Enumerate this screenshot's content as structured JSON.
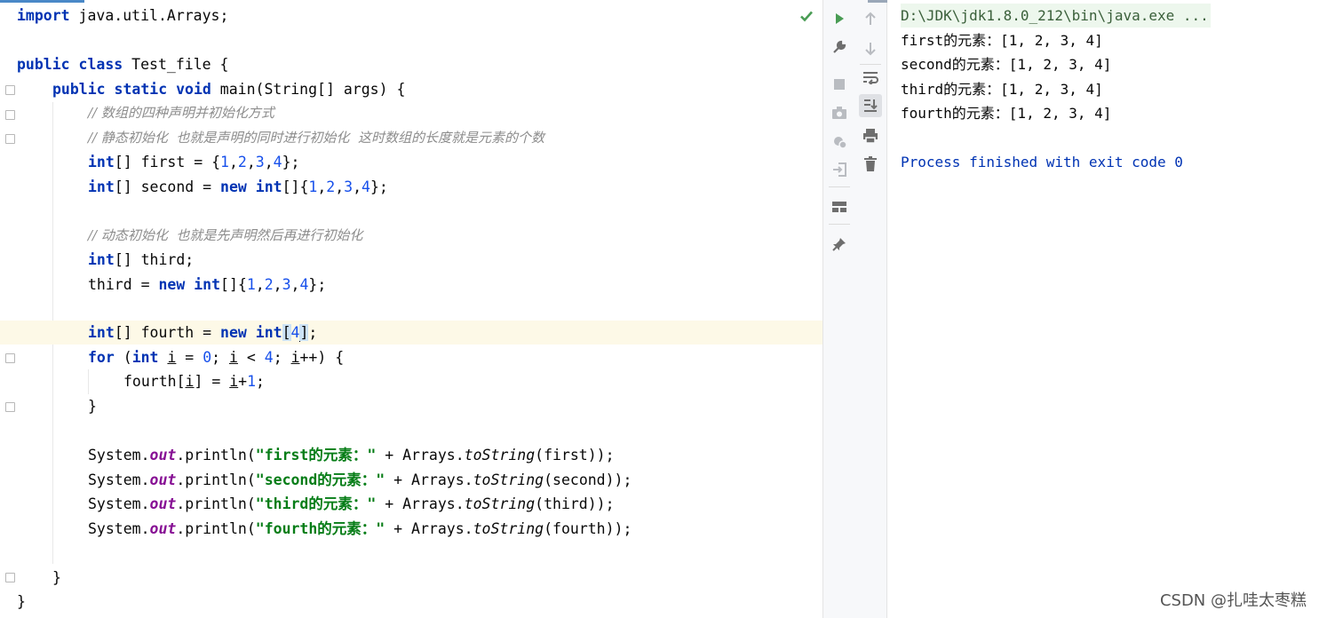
{
  "editor": {
    "status_icon": "checkmark-icon",
    "lines": {
      "l1": {
        "kw": "import",
        "rest": " java.util.Arrays;"
      },
      "l3": {
        "kw1": "public",
        "kw2": "class",
        "rest": " Test_file {"
      },
      "l4": {
        "kw1": "public",
        "kw2": "static",
        "kw3": "void",
        "rest": " main(String[] args) {"
      },
      "l5": {
        "comment": "// 数组的四种声明并初始化方式"
      },
      "l6": {
        "comment": "// 静态初始化  也就是声明的同时进行初始化  这时数组的长度就是元素的个数"
      },
      "l7": {
        "kw": "int",
        "a": "[] first = {",
        "n1": "1",
        "c1": ",",
        "n2": "2",
        "c2": ",",
        "n3": "3",
        "c3": ",",
        "n4": "4",
        "end": "};"
      },
      "l8": {
        "kw": "int",
        "a": "[] second = ",
        "kw2": "new",
        "sp": " ",
        "kw3": "int",
        "b": "[]{",
        "n1": "1",
        "c1": ",",
        "n2": "2",
        "c2": ",",
        "n3": "3",
        "c3": ",",
        "n4": "4",
        "end": "};"
      },
      "l10": {
        "comment": "// 动态初始化  也就是先声明然后再进行初始化"
      },
      "l11": {
        "kw": "int",
        "rest": "[] third;"
      },
      "l12": {
        "a": "third = ",
        "kw": "new",
        "sp": " ",
        "kw2": "int",
        "b": "[]{",
        "n1": "1",
        "c1": ",",
        "n2": "2",
        "c2": ",",
        "n3": "3",
        "c3": ",",
        "n4": "4",
        "end": "};"
      },
      "l14": {
        "kw": "int",
        "a": "[] fourth = ",
        "kw2": "new",
        "sp": " ",
        "kw3": "int",
        "ob": "[",
        "n": "4",
        "cb": "]",
        "end": ";"
      },
      "l15": {
        "kw": "for",
        "a": " (",
        "kw2": "int",
        "sp": " ",
        "v1": "i",
        "b": " = ",
        "n0": "0",
        "c": "; ",
        "v2": "i",
        "d": " < ",
        "n4": "4",
        "e": "; ",
        "v3": "i",
        "f": "++) {"
      },
      "l16": {
        "a": "fourth[",
        "v": "i",
        "b": "] = ",
        "v2": "i",
        "c": "+",
        "n": "1",
        "end": ";"
      },
      "l17": {
        "text": "}"
      },
      "p1": {
        "sys": "System.",
        "out": "out",
        "pl": ".println(",
        "str": "\"first的元素：\"",
        "plus": " + Arrays.",
        "ts": "toString",
        "arg": "(first));"
      },
      "p2": {
        "sys": "System.",
        "out": "out",
        "pl": ".println(",
        "str": "\"second的元素：\"",
        "plus": " + Arrays.",
        "ts": "toString",
        "arg": "(second));"
      },
      "p3": {
        "sys": "System.",
        "out": "out",
        "pl": ".println(",
        "str": "\"third的元素：\"",
        "plus": " + Arrays.",
        "ts": "toString",
        "arg": "(third));"
      },
      "p4": {
        "sys": "System.",
        "out": "out",
        "pl": ".println(",
        "str": "\"fourth的元素：\"",
        "plus": " + Arrays.",
        "ts": "toString",
        "arg": "(fourth));"
      },
      "l24": {
        "text": "}"
      },
      "l25": {
        "text": "}"
      }
    },
    "gutter_icons": {
      "intention": "lightbulb-icon"
    }
  },
  "run_toolbar": {
    "left": [
      "run-icon",
      "wrench-icon",
      "stop-icon",
      "camera-icon",
      "settings-bug-icon",
      "login-icon",
      "layout-icon",
      "pin-icon"
    ],
    "right": [
      "arrow-up-icon",
      "arrow-down-icon",
      "soft-wrap-icon",
      "scroll-to-end-icon",
      "print-icon",
      "trash-icon"
    ]
  },
  "console": {
    "command": "D:\\JDK\\jdk1.8.0_212\\bin\\java.exe ...",
    "output": [
      "first的元素：[1, 2, 3, 4]",
      "second的元素：[1, 2, 3, 4]",
      "third的元素：[1, 2, 3, 4]",
      "fourth的元素：[1, 2, 3, 4]"
    ],
    "exit": "Process finished with exit code 0"
  },
  "watermark": "CSDN @扎哇太枣糕"
}
